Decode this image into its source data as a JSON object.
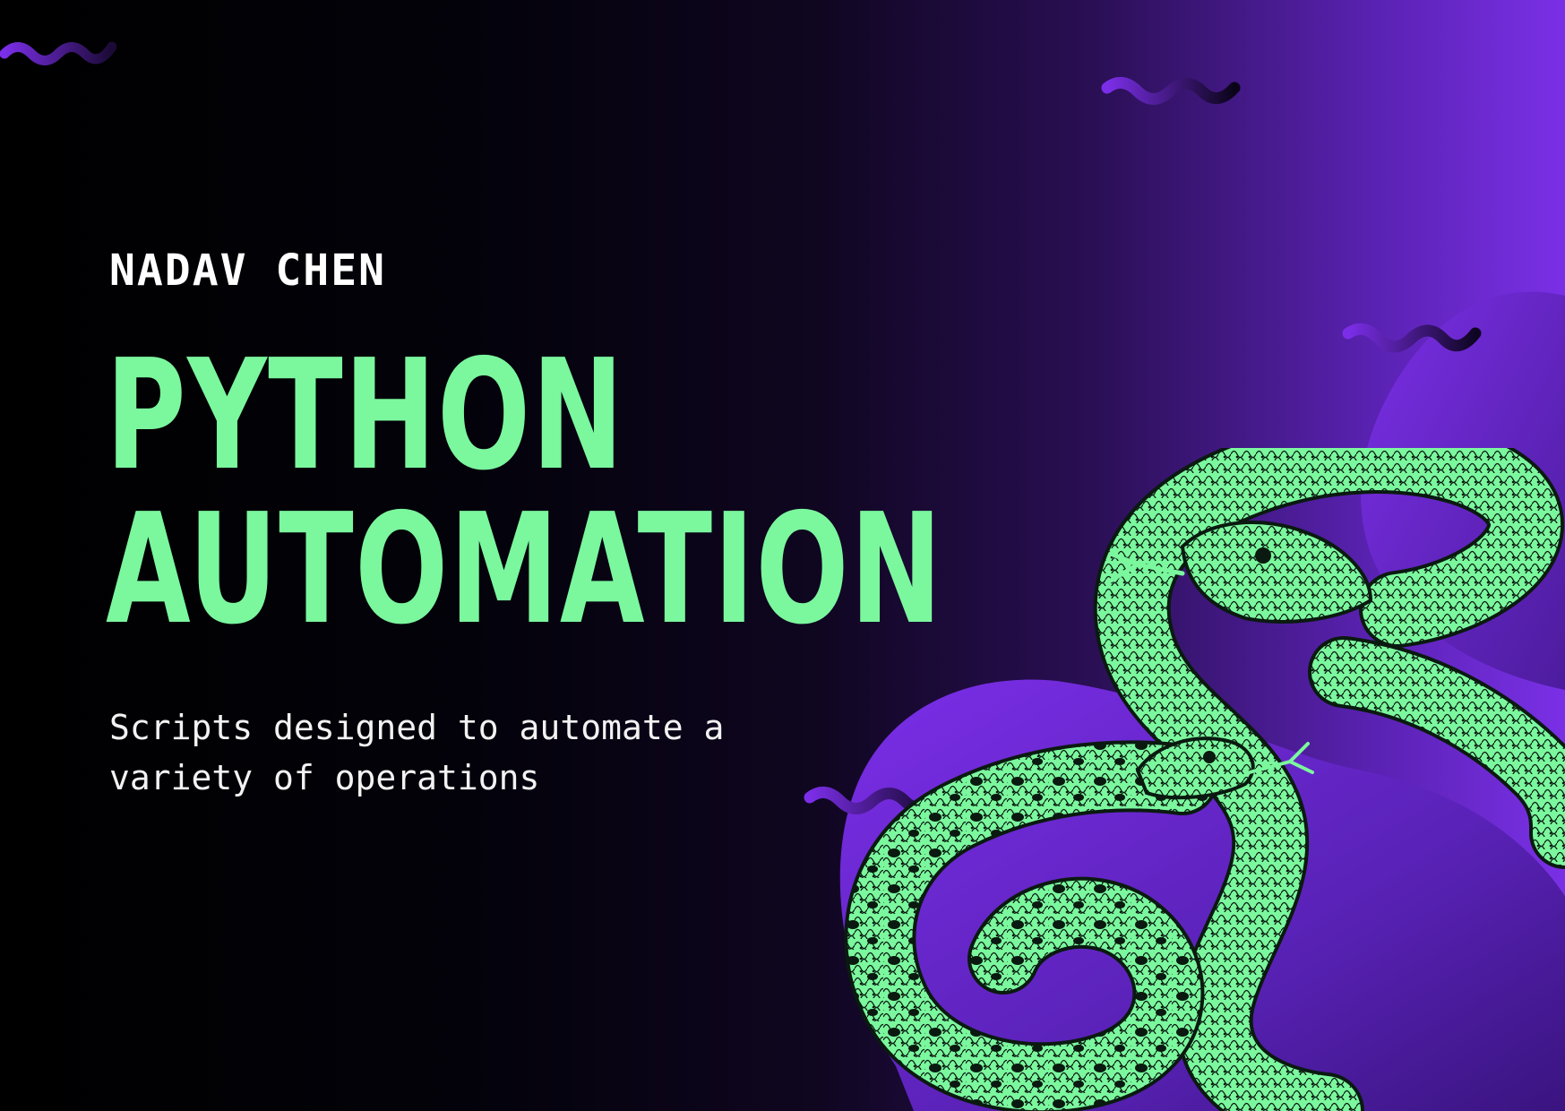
{
  "author": "NADAV CHEN",
  "title_lines": [
    "PYTHON",
    "AUTOMATION"
  ],
  "subtitle": "Scripts designed to automate a variety of operations",
  "colors": {
    "title_green": "#7bf79e",
    "snake_green": "#7bf79e",
    "purple_accent": "#7a30e6",
    "background_dark": "#000000"
  },
  "decorations": {
    "squiggles": [
      "wave-squiggle",
      "wave-squiggle",
      "wave-squiggle",
      "wave-squiggle"
    ],
    "illustration": "intertwined-snakes"
  }
}
